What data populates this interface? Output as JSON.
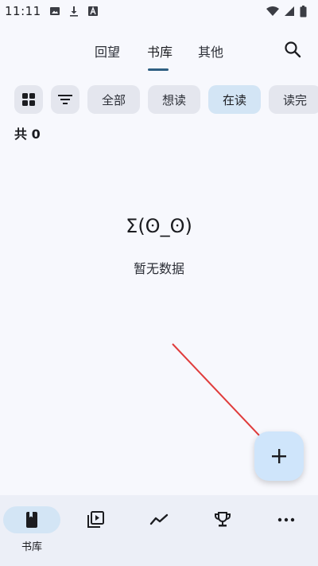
{
  "status_bar": {
    "time": "11:11",
    "icons": [
      "image-icon",
      "download-icon",
      "font-a-icon",
      "wifi-icon",
      "signal-icon",
      "battery-icon"
    ]
  },
  "top_nav": {
    "tabs": [
      {
        "label": "回望",
        "active": false
      },
      {
        "label": "书库",
        "active": true
      },
      {
        "label": "其他",
        "active": false
      }
    ],
    "indicator_color": "#2f5f82"
  },
  "filters": {
    "chips": [
      {
        "label": "全部",
        "selected": false
      },
      {
        "label": "想读",
        "selected": false
      },
      {
        "label": "在读",
        "selected": true
      },
      {
        "label": "读完",
        "selected": false
      }
    ]
  },
  "count": {
    "label": "共 0"
  },
  "empty_state": {
    "face": "Σ(ʘ_ʘ)",
    "text": "暂无数据"
  },
  "fab": {
    "icon": "plus-icon"
  },
  "bottom_nav": {
    "items": [
      {
        "icon": "book-icon",
        "label": "书库",
        "active": true
      },
      {
        "icon": "playlist-icon",
        "active": false
      },
      {
        "icon": "trend-icon",
        "active": false
      },
      {
        "icon": "trophy-icon",
        "active": false
      },
      {
        "icon": "more-icon",
        "active": false
      }
    ]
  },
  "colors": {
    "background": "#f7f8fd",
    "chip": "#e4e6ee",
    "chip_selected": "#d3e5f5",
    "fab": "#cfe5fb",
    "annotation_arrow": "#e03c3c"
  }
}
